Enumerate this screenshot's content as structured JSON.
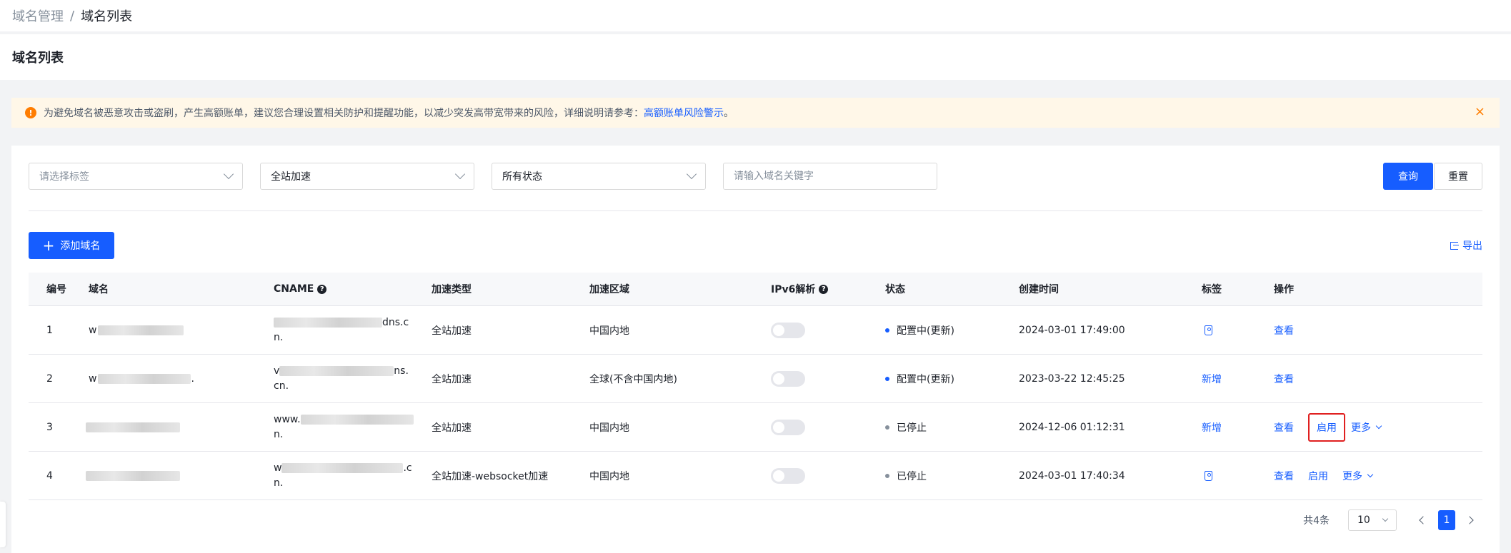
{
  "breadcrumb": {
    "parent": "域名管理",
    "separator": "/",
    "current": "域名列表"
  },
  "page_title": "域名列表",
  "alert": {
    "icon": "warning-icon",
    "text": "为避免域名被恶意攻击或盗刷，产生高额账单，建议您合理设置相关防护和提醒功能，以减少突发高带宽带来的风险，详细说明请参考：",
    "link": "高额账单风险警示",
    "suffix": "。",
    "close_icon": "×"
  },
  "filters": {
    "tag_placeholder": "请选择标签",
    "accel_type": "全站加速",
    "status": "所有状态",
    "keyword_placeholder": "请输入域名关键字",
    "search_label": "查询",
    "reset_label": "重置"
  },
  "toolbar": {
    "add_label": "添加域名",
    "add_icon": "+",
    "export_label": "导出"
  },
  "table": {
    "columns": [
      "编号",
      "域名",
      "CNAME",
      "加速类型",
      "加速区域",
      "IPv6解析",
      "状态",
      "创建时间",
      "标签",
      "操作"
    ],
    "rows": [
      {
        "id": "1",
        "domain_prefix": "w",
        "domain_suffix": "",
        "cname_line1_prefix": "",
        "cname_line1_suffix": "dns.c",
        "cname_line2": "n.",
        "accel_type": "全站加速",
        "region": "中国内地",
        "ipv6": false,
        "status": "配置中(更新)",
        "status_color": "#165dff",
        "created": "2024-03-01 17:49:00",
        "tag": "",
        "tag_icon": true,
        "ops": [
          "查看"
        ]
      },
      {
        "id": "2",
        "domain_prefix": "w",
        "domain_suffix": ".",
        "cname_line1_prefix": "v",
        "cname_line1_suffix": "ns.",
        "cname_line2": "cn.",
        "accel_type": "全站加速",
        "region": "全球(不含中国内地)",
        "ipv6": false,
        "status": "配置中(更新)",
        "status_color": "#165dff",
        "created": "2023-03-22 12:45:25",
        "tag": "新增",
        "tag_icon": false,
        "ops": [
          "查看"
        ]
      },
      {
        "id": "3",
        "domain_prefix": "",
        "domain_suffix": "",
        "cname_line1_prefix": "www.",
        "cname_line1_suffix": "",
        "cname_line2": "n.",
        "accel_type": "全站加速",
        "region": "中国内地",
        "ipv6": false,
        "status": "已停止",
        "status_color": "#86909c",
        "created": "2024-12-06 01:12:31",
        "tag": "新增",
        "tag_icon": false,
        "ops": [
          "查看",
          "启用",
          "更多"
        ]
      },
      {
        "id": "4",
        "domain_prefix": "",
        "domain_suffix": "",
        "cname_line1_prefix": "w",
        "cname_line1_suffix": ".c",
        "cname_line2": "n.",
        "accel_type": "全站加速-websocket加速",
        "region": "中国内地",
        "ipv6": false,
        "status": "已停止",
        "status_color": "#86909c",
        "created": "2024-03-01 17:40:34",
        "tag": "",
        "tag_icon": true,
        "ops": [
          "查看",
          "启用",
          "更多"
        ]
      }
    ]
  },
  "pagination": {
    "total": "共4条",
    "page_size": "10",
    "current_page": "1"
  },
  "colors": {
    "primary": "#165dff",
    "warning": "#ff7d00",
    "highlight_border": "#e02020"
  }
}
